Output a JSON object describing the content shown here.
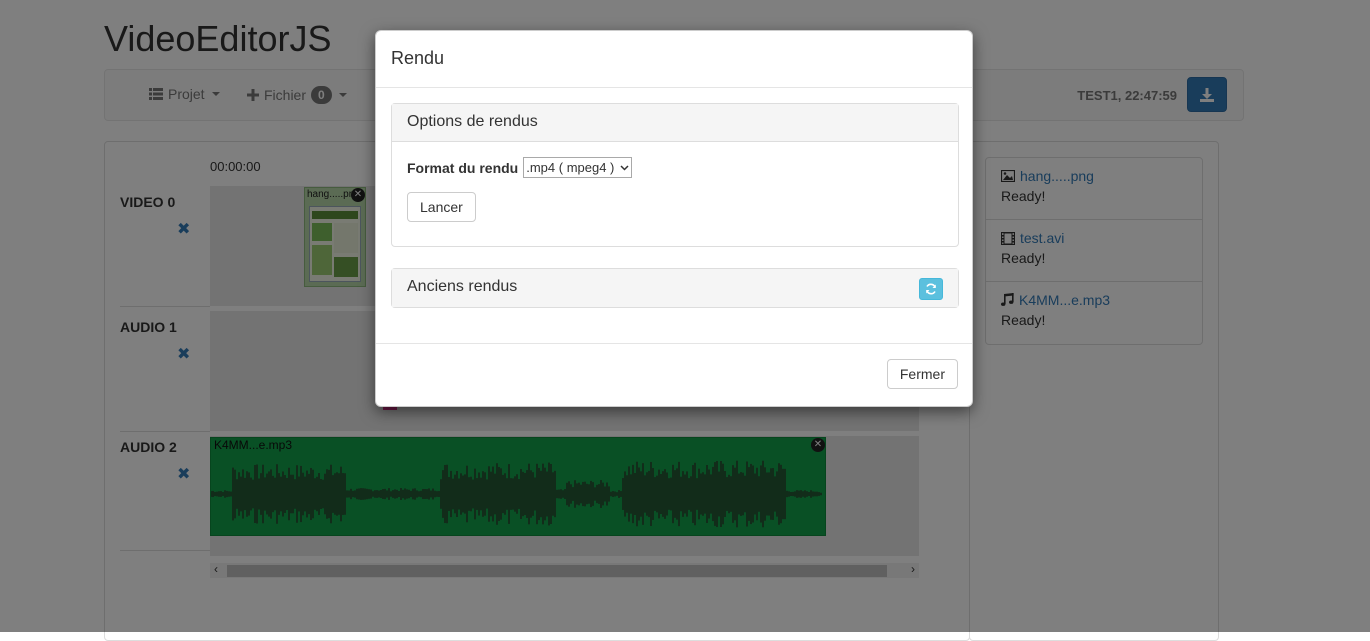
{
  "app": {
    "title": "VideoEditorJS"
  },
  "navbar": {
    "projet_label": "Projet",
    "fichier_label": "Fichier",
    "fichier_count": "0",
    "status": "TEST1, 22:47:59"
  },
  "timeline": {
    "timecode": "00:00:00",
    "tracks": [
      {
        "label": "VIDEO 0"
      },
      {
        "label": "AUDIO 1"
      },
      {
        "label": "AUDIO 2"
      }
    ],
    "image_clip_name": "hang.....png",
    "audio_clip_name": "K4MM...e.mp3"
  },
  "files": [
    {
      "icon": "image-icon",
      "name": "hang.....png",
      "status": "Ready!"
    },
    {
      "icon": "film-icon",
      "name": "test.avi",
      "status": "Ready!"
    },
    {
      "icon": "music-icon",
      "name": "K4MM...e.mp3",
      "status": "Ready!"
    }
  ],
  "modal": {
    "title": "Rendu",
    "options_heading": "Options de rendus",
    "format_label": "Format du rendu",
    "format_value": ".mp4 ( mpeg4 )",
    "launch_label": "Lancer",
    "previous_heading": "Anciens rendus",
    "close_label": "Fermer"
  },
  "colors": {
    "primary": "#337ab7",
    "audio_clip": "#13a04a",
    "info": "#5bc0de"
  }
}
